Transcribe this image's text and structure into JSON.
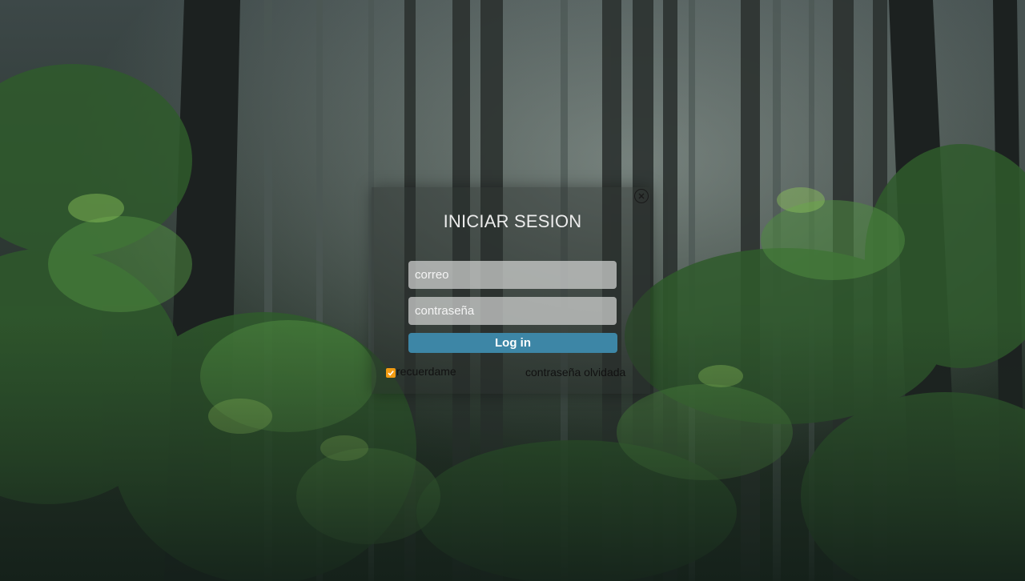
{
  "login": {
    "title": "INICIAR SESION",
    "email_placeholder": "correo",
    "password_placeholder": "contraseña",
    "login_button": "Log in",
    "remember_label": "recuerdame",
    "remember_checked": true,
    "forgot_link": "contraseña olvidada"
  },
  "colors": {
    "button": "#3d86a6",
    "checkbox": "#f29b12"
  },
  "icons": {
    "close": "close-circle-icon",
    "check": "checkmark-icon"
  }
}
